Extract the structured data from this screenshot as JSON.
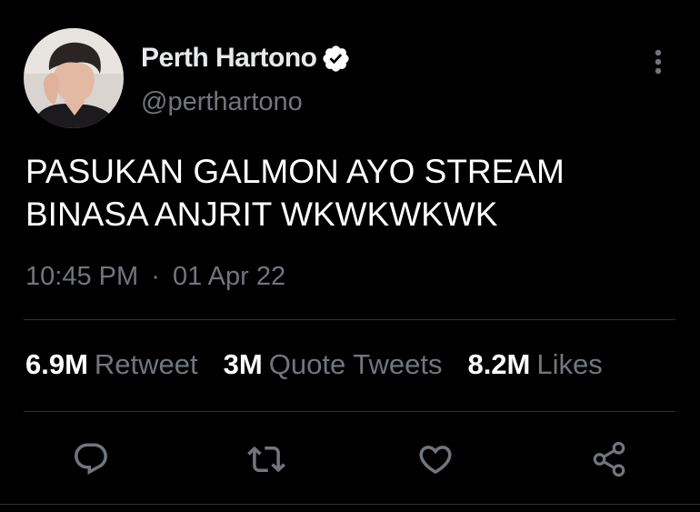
{
  "user": {
    "display_name": "Perth Hartono",
    "handle": "@perthartono",
    "verified": true,
    "avatar": "profile-photo"
  },
  "tweet": {
    "text": "PASUKAN GALMON AYO STREAM\nBINASA ANJRIT WKWKWKWK",
    "time": "10:45 PM",
    "separator": "·",
    "date": "01 Apr 22"
  },
  "stats": [
    {
      "count": "6.9M",
      "label": "Retweet"
    },
    {
      "count": "3M",
      "label": "Quote Tweets"
    },
    {
      "count": "8.2M",
      "label": "Likes"
    }
  ],
  "actions": {
    "icons": [
      "reply-icon",
      "retweet-icon",
      "like-icon",
      "share-icon"
    ]
  },
  "colors": {
    "background": "#000000",
    "primary_text": "#e7e9ea",
    "secondary_text": "#71767b",
    "divider": "#2f3336",
    "verified_badge": "#ffffff"
  }
}
